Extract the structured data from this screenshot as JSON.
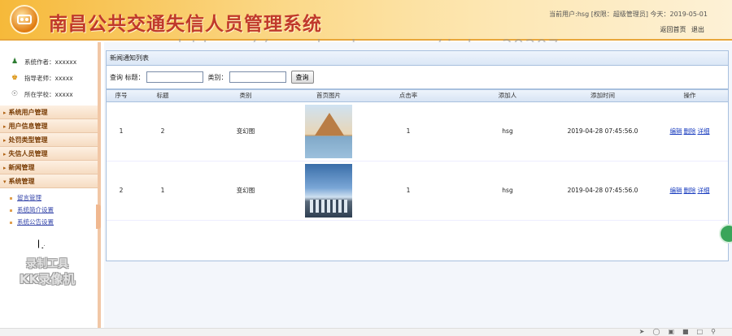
{
  "header": {
    "title": "南昌公共交通失信人员管理系统",
    "user_info": "当前用户:hsg [权限：超级管理员] 今天：2019-05-01",
    "home_link": "返回首页",
    "logout_link": "退出"
  },
  "watermark": "https://www.huzhan.com/ishop39397",
  "sidebar": {
    "info": [
      {
        "label": "系统作者：xxxxxx",
        "icon": "user-icon"
      },
      {
        "label": "指导老师：xxxxx",
        "icon": "teacher-icon"
      },
      {
        "label": "所在学校：xxxxx",
        "icon": "school-icon"
      }
    ],
    "menu": [
      {
        "label": "系统用户管理"
      },
      {
        "label": "用户信息管理"
      },
      {
        "label": "处罚类型管理"
      },
      {
        "label": "失信人员管理"
      },
      {
        "label": "新闻管理"
      },
      {
        "label": "系统管理"
      }
    ],
    "submenu": [
      {
        "label": "留言管理"
      },
      {
        "label": "系统简介设置"
      },
      {
        "label": "系统公告设置"
      }
    ],
    "kk_line1": "录制工具",
    "kk_line2": "KK录像机"
  },
  "main": {
    "panel_title": "新闻通知列表",
    "search": {
      "label_query": "查询",
      "label_title": "标题：",
      "label_category": "类别：",
      "title_value": "",
      "category_value": "",
      "button": "查询"
    },
    "columns": [
      "序号",
      "标题",
      "类别",
      "首页图片",
      "点击率",
      "添加人",
      "添加时间",
      "操作"
    ],
    "rows": [
      {
        "index": "1",
        "title": "2",
        "category": "变幻图",
        "clicks": "1",
        "adder": "hsg",
        "time": "2019-04-28 07:45:56.0",
        "image": "pyramid"
      },
      {
        "index": "2",
        "title": "1",
        "category": "变幻图",
        "clicks": "1",
        "adder": "hsg",
        "time": "2019-04-28 07:45:56.0",
        "image": "city"
      }
    ],
    "ops": {
      "edit": "编辑",
      "delete": "删除",
      "detail": "详细"
    }
  },
  "colors": {
    "accent": "#c0392b",
    "header_bg": "#f6b93a",
    "link": "#1a3dbf"
  }
}
